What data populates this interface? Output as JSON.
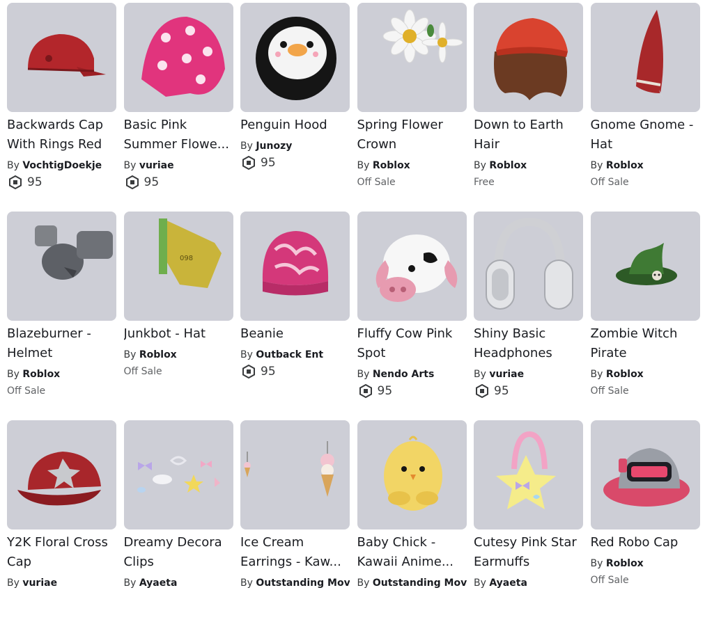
{
  "items": [
    {
      "title": "Backwards Cap With Rings Red",
      "by": "By",
      "creator": "VochtigDoekje",
      "price": "95",
      "icon": "red-cap-icon"
    },
    {
      "title": "Basic Pink Summer Flowe...",
      "by": "By",
      "creator": "vuriae",
      "price": "95",
      "icon": "pink-bandana-icon"
    },
    {
      "title": "Penguin Hood",
      "by": "By",
      "creator": "Junozy",
      "price": "95",
      "icon": "penguin-hood-icon"
    },
    {
      "title": "Spring Flower Crown",
      "by": "By",
      "creator": "Roblox",
      "status": "Off Sale",
      "icon": "flower-crown-icon"
    },
    {
      "title": "Down to Earth Hair",
      "by": "By",
      "creator": "Roblox",
      "status": "Free",
      "icon": "hair-beanie-icon"
    },
    {
      "title": "Gnome Gnome - Hat",
      "by": "By",
      "creator": "Roblox",
      "status": "Off Sale",
      "icon": "gnome-hat-icon"
    },
    {
      "title": "Blazeburner - Helmet",
      "by": "By",
      "creator": "Roblox",
      "status": "Off Sale",
      "icon": "robot-helmet-icon"
    },
    {
      "title": "Junkbot - Hat",
      "by": "By",
      "creator": "Roblox",
      "status": "Off Sale",
      "icon": "junkbot-hat-icon"
    },
    {
      "title": "Beanie",
      "by": "By",
      "creator": "Outback Ent",
      "price": "95",
      "icon": "pink-beanie-icon"
    },
    {
      "title": "Fluffy Cow Pink Spot",
      "by": "By",
      "creator": "Nendo Arts",
      "price": "95",
      "icon": "cow-hat-icon"
    },
    {
      "title": "Shiny Basic Headphones",
      "by": "By",
      "creator": "vuriae",
      "price": "95",
      "icon": "headphones-icon"
    },
    {
      "title": "Zombie Witch Pirate",
      "by": "By",
      "creator": "Roblox",
      "status": "Off Sale",
      "icon": "witch-hat-icon"
    },
    {
      "title": "Y2K Floral Cross Cap",
      "by": "By",
      "creator": "vuriae",
      "icon": "cross-cap-icon"
    },
    {
      "title": "Dreamy Decora Clips",
      "by": "By",
      "creator": "Ayaeta",
      "icon": "hair-clips-icon"
    },
    {
      "title": "Ice Cream Earrings - Kaw...",
      "by": "By",
      "creator": "Outstanding Move",
      "icon": "ice-cream-earrings-icon"
    },
    {
      "title": "Baby Chick - Kawaii Anime...",
      "by": "By",
      "creator": "Outstanding Move",
      "icon": "baby-chick-icon"
    },
    {
      "title": "Cutesy Pink Star Earmuffs",
      "by": "By",
      "creator": "Ayaeta",
      "icon": "star-earmuffs-icon"
    },
    {
      "title": "Red Robo Cap",
      "by": "By",
      "creator": "Roblox",
      "status": "Off Sale",
      "icon": "robo-cap-icon"
    }
  ]
}
